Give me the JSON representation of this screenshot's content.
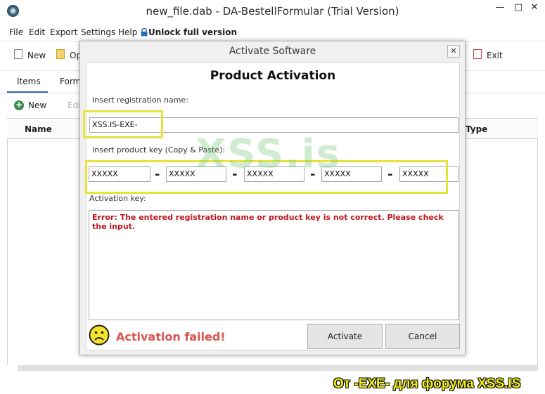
{
  "window": {
    "title": "new_file.dab - DA-BestellFormular (Trial Version)",
    "minimize": "—",
    "maximize": "□",
    "close": "✕"
  },
  "menu": {
    "file": "File",
    "edit": "Edit",
    "export": "Export",
    "settings": "Settings",
    "help": "Help",
    "unlock": "Unlock full version"
  },
  "toolbar": {
    "new": "New",
    "open": "Op",
    "exit": "Exit"
  },
  "tabs": {
    "items": "Items",
    "form": "Form"
  },
  "subtoolbar": {
    "new": "New",
    "edit": "Edi"
  },
  "grid": {
    "col_name": "Name",
    "col_type": "Type"
  },
  "dialog": {
    "title": "Activate Software",
    "close": "✕",
    "heading": "Product Activation",
    "reg_name_label": "Insert registration name:",
    "reg_name_value": "XSS.IS-EXE-",
    "key_label": "Insert product key (Copy & Paste):",
    "key_parts": [
      "XXXXX",
      "XXXXX",
      "XXXXX",
      "XXXXX",
      "XXXXX"
    ],
    "dash": "-",
    "activation_label": "Activation key:",
    "error": "Error: The entered registration name or product key is not correct. Please check the input.",
    "status": "Activation failed!",
    "activate_button": "Activate",
    "cancel_button": "Cancel"
  },
  "watermark": "XSS.is",
  "footer": "От -EXE- для форума XSS.IS",
  "colors": {
    "error": "#c0161c",
    "fail": "#d9534f",
    "highlight": "#e8e23a",
    "accent": "#2b6cb0"
  },
  "icons": {
    "app": "app-icon",
    "lock": "lock-icon",
    "smiley": "sad-face-icon"
  }
}
